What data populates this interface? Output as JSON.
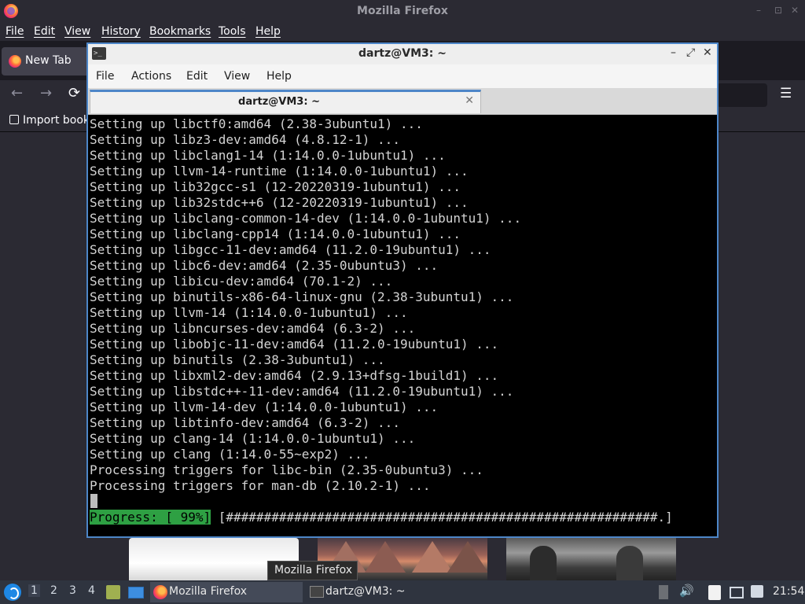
{
  "firefox": {
    "window_title": "Mozilla Firefox",
    "window_controls": {
      "minimize": "–",
      "restore": "⊡",
      "close": "✕"
    },
    "menu": [
      "File",
      "Edit",
      "View",
      "History",
      "Bookmarks",
      "Tools",
      "Help"
    ],
    "tab_label": "New Tab",
    "nav_icons": {
      "back": "←",
      "forward": "→",
      "reload": "⟳",
      "menu": "☰"
    },
    "bookmark_label": "Import book"
  },
  "terminal": {
    "window_title": "dartz@VM3: ~",
    "window_controls": {
      "minimize": "–",
      "maximize": "⤢",
      "close": "✕"
    },
    "menu": [
      "File",
      "Actions",
      "Edit",
      "View",
      "Help"
    ],
    "tab_label": "dartz@VM3: ~",
    "tab_close": "✕",
    "output_lines": [
      "Setting up libctf0:amd64 (2.38-3ubuntu1) ...",
      "Setting up libz3-dev:amd64 (4.8.12-1) ...",
      "Setting up libclang1-14 (1:14.0.0-1ubuntu1) ...",
      "Setting up llvm-14-runtime (1:14.0.0-1ubuntu1) ...",
      "Setting up lib32gcc-s1 (12-20220319-1ubuntu1) ...",
      "Setting up lib32stdc++6 (12-20220319-1ubuntu1) ...",
      "Setting up libclang-common-14-dev (1:14.0.0-1ubuntu1) ...",
      "Setting up libclang-cpp14 (1:14.0.0-1ubuntu1) ...",
      "Setting up libgcc-11-dev:amd64 (11.2.0-19ubuntu1) ...",
      "Setting up libc6-dev:amd64 (2.35-0ubuntu3) ...",
      "Setting up libicu-dev:amd64 (70.1-2) ...",
      "Setting up binutils-x86-64-linux-gnu (2.38-3ubuntu1) ...",
      "Setting up llvm-14 (1:14.0.0-1ubuntu1) ...",
      "Setting up libncurses-dev:amd64 (6.3-2) ...",
      "Setting up libobjc-11-dev:amd64 (11.2.0-19ubuntu1) ...",
      "Setting up binutils (2.38-3ubuntu1) ...",
      "Setting up libxml2-dev:amd64 (2.9.13+dfsg-1build1) ...",
      "Setting up libstdc++-11-dev:amd64 (11.2.0-19ubuntu1) ...",
      "Setting up llvm-14-dev (1:14.0.0-1ubuntu1) ...",
      "Setting up libtinfo-dev:amd64 (6.3-2) ...",
      "Setting up clang-14 (1:14.0.0-1ubuntu1) ...",
      "Setting up clang (1:14.0-55~exp2) ...",
      "Processing triggers for libc-bin (2.35-0ubuntu3) ...",
      "Processing triggers for man-db (2.10.2-1) ..."
    ],
    "progress_label": "Progress: [ 99%]",
    "progress_bar": " [#########################################################.]",
    "progress_percent": 99
  },
  "tooltip": "Mozilla Firefox",
  "taskbar": {
    "workspaces": [
      "1",
      "2",
      "3",
      "4"
    ],
    "active_workspace": "1",
    "tasks": [
      {
        "label": "Mozilla Firefox"
      },
      {
        "label": "dartz@VM3: ~"
      }
    ],
    "volume_icon": "🔊",
    "clock": "21:54"
  },
  "colors": {
    "firefox_bg": "#2b2a33",
    "terminal_accent": "#4d86c8",
    "progress_green": "#2ea043",
    "taskbar_bg": "#2f343f"
  }
}
